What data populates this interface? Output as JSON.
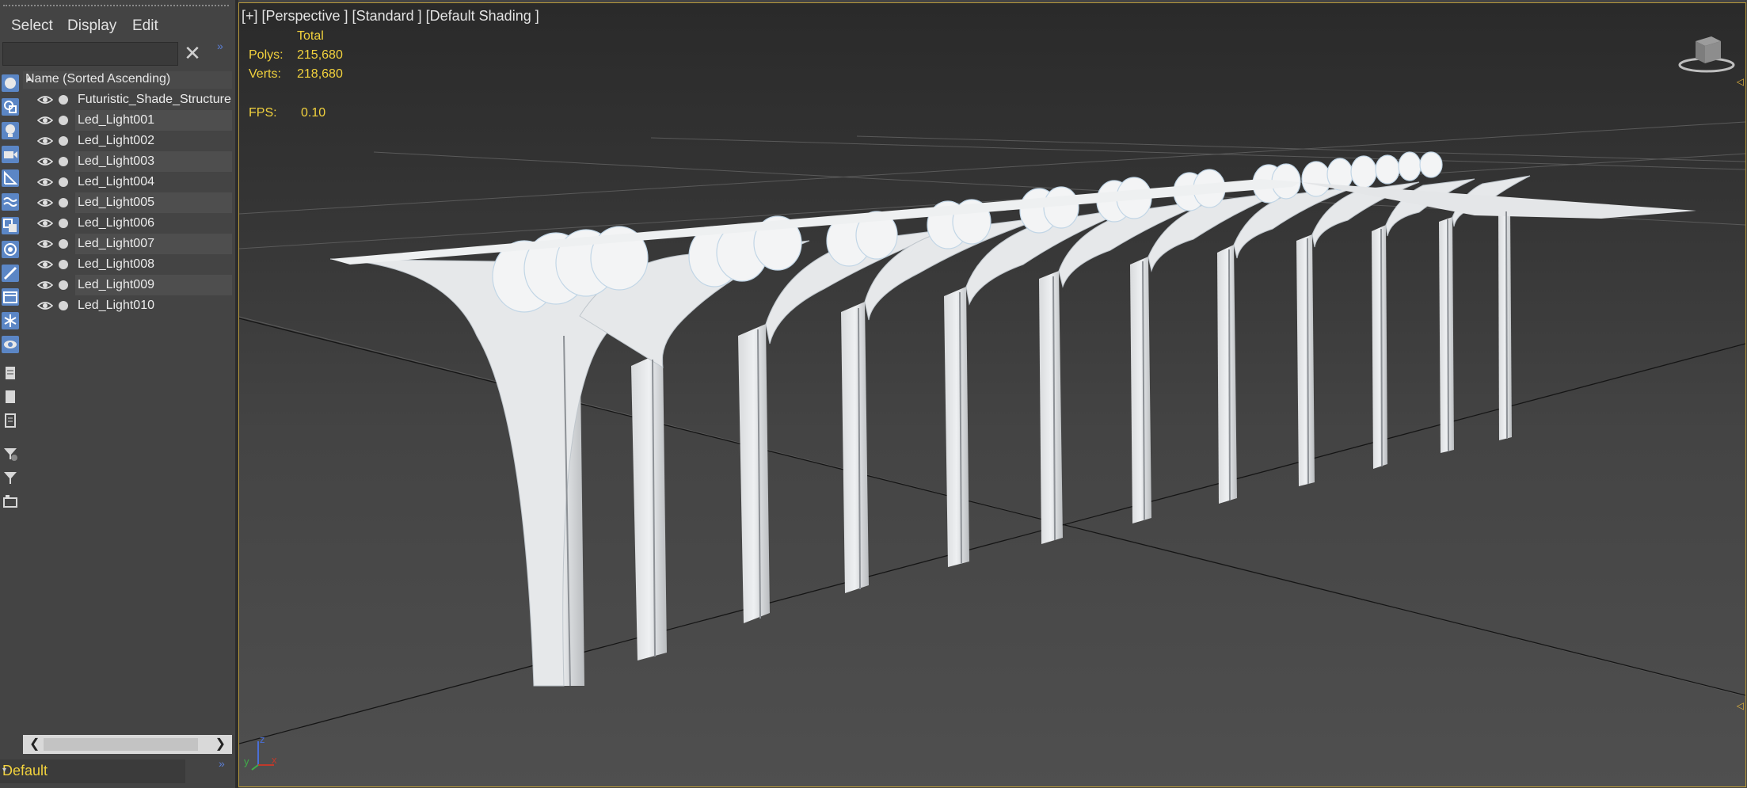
{
  "explorer": {
    "menu": [
      "Select",
      "Display",
      "Edit"
    ],
    "search_value": "",
    "list_header": "Name (Sorted Ascending)",
    "items": [
      {
        "label": "Futuristic_Shade_Structure"
      },
      {
        "label": "Led_Light001"
      },
      {
        "label": "Led_Light002"
      },
      {
        "label": "Led_Light003"
      },
      {
        "label": "Led_Light004"
      },
      {
        "label": "Led_Light005"
      },
      {
        "label": "Led_Light006"
      },
      {
        "label": "Led_Light007"
      },
      {
        "label": "Led_Light008"
      },
      {
        "label": "Led_Light009"
      },
      {
        "label": "Led_Light010"
      }
    ],
    "layer": "Default"
  },
  "viewport": {
    "label": "[+] [Perspective ] [Standard ] [Default Shading ]",
    "stats": {
      "total_label": "Total",
      "polys_label": "Polys:",
      "polys_value": "215,680",
      "verts_label": "Verts:",
      "verts_value": "218,680",
      "fps_label": "FPS:",
      "fps_value": "0.10"
    },
    "axis": {
      "x": "x",
      "y": "y",
      "z": "z"
    }
  },
  "colors": {
    "stats": "#f2d23d",
    "active_border": "#b89a3c",
    "tool_blue": "#5b86c5"
  },
  "icons": [
    "eye-icon",
    "render-dot-icon",
    "close-icon",
    "viewcube-icon"
  ]
}
